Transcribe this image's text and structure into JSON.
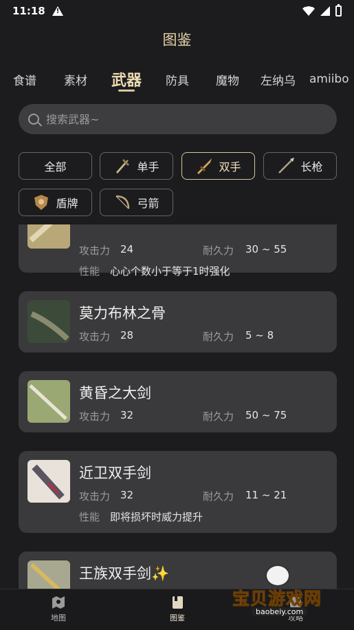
{
  "status_bar": {
    "time": "11:18"
  },
  "page_title": "图鉴",
  "tabs": [
    {
      "label": "食谱"
    },
    {
      "label": "素材"
    },
    {
      "label": "武器"
    },
    {
      "label": "防具"
    },
    {
      "label": "魔物"
    },
    {
      "label": "左纳乌"
    },
    {
      "label": "amiibo"
    }
  ],
  "active_tab": "武器",
  "search": {
    "placeholder": "搜索武器~",
    "value": ""
  },
  "filters": [
    {
      "label": "全部",
      "icon": "none"
    },
    {
      "label": "单手",
      "icon": "one-handed-weapon-icon"
    },
    {
      "label": "双手",
      "icon": "two-handed-weapon-icon"
    },
    {
      "label": "长枪",
      "icon": "spear-icon"
    },
    {
      "label": "盾牌",
      "icon": "shield-icon"
    },
    {
      "label": "弓箭",
      "icon": "bow-icon"
    }
  ],
  "active_filter": "双手",
  "stat_labels": {
    "attack": "攻击力",
    "durability": "耐久力",
    "trait": "性能"
  },
  "weapons": [
    {
      "name": "",
      "attack": "24",
      "durability": "30 ~ 55",
      "trait": "心心个数小于等于1时强化"
    },
    {
      "name": "莫力布林之骨",
      "attack": "28",
      "durability": "5 ~ 8",
      "trait": ""
    },
    {
      "name": "黄昏之大剑",
      "attack": "32",
      "durability": "50 ~ 75",
      "trait": ""
    },
    {
      "name": "近卫双手剑",
      "attack": "32",
      "durability": "11 ~ 21",
      "trait": "即将损坏时威力提升"
    },
    {
      "name": "王族双手剑✨",
      "attack": "",
      "durability": "",
      "trait": ""
    }
  ],
  "bottom_nav": [
    {
      "label": "地图",
      "icon": "map-icon"
    },
    {
      "label": "图鉴",
      "icon": "book-icon"
    },
    {
      "label": "攻略",
      "icon": "guide-icon"
    }
  ],
  "watermark": {
    "text": "宝贝游戏网",
    "url": "baobeiy.com"
  },
  "colors": {
    "background": "#1c1c1e",
    "card": "#3a3a3c",
    "accent": "#d9c89a"
  }
}
